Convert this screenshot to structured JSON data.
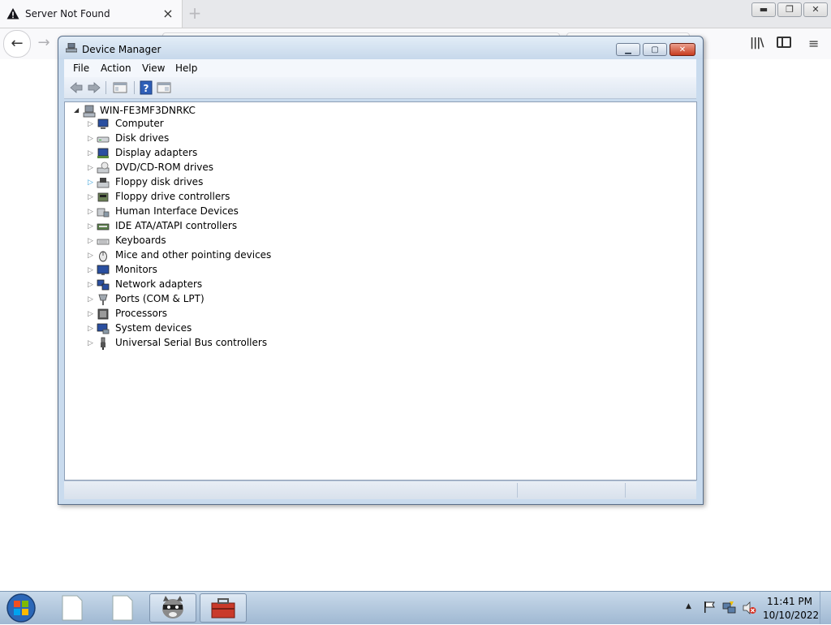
{
  "browser": {
    "tab_title": "Server Not Found",
    "tab_close": "×",
    "new_tab": "+",
    "back": "←",
    "forward": "→",
    "library": "|||\\",
    "menu": "≡"
  },
  "window": {
    "title": "Device Manager",
    "menus": [
      "File",
      "Action",
      "View",
      "Help"
    ],
    "root_node": "WIN-FE3MF3DNRKC",
    "categories": [
      {
        "label": "Computer",
        "icon": "computer-icon"
      },
      {
        "label": "Disk drives",
        "icon": "disk-drive-icon"
      },
      {
        "label": "Display adapters",
        "icon": "display-adapter-icon"
      },
      {
        "label": "DVD/CD-ROM drives",
        "icon": "dvd-drive-icon"
      },
      {
        "label": "Floppy disk drives",
        "icon": "floppy-disk-icon"
      },
      {
        "label": "Floppy drive controllers",
        "icon": "floppy-controller-icon"
      },
      {
        "label": "Human Interface Devices",
        "icon": "hid-icon"
      },
      {
        "label": "IDE ATA/ATAPI controllers",
        "icon": "ide-controller-icon"
      },
      {
        "label": "Keyboards",
        "icon": "keyboard-icon"
      },
      {
        "label": "Mice and other pointing devices",
        "icon": "mouse-icon"
      },
      {
        "label": "Monitors",
        "icon": "monitor-icon"
      },
      {
        "label": "Network adapters",
        "icon": "network-adapter-icon"
      },
      {
        "label": "Ports (COM & LPT)",
        "icon": "port-icon"
      },
      {
        "label": "Processors",
        "icon": "processor-icon"
      },
      {
        "label": "System devices",
        "icon": "system-device-icon"
      },
      {
        "label": "Universal Serial Bus controllers",
        "icon": "usb-icon"
      }
    ]
  },
  "taskbar": {
    "time": "11:41 PM",
    "date": "10/10/2022",
    "buttons": [
      "file-icon",
      "file-icon",
      "raccoon-app-icon",
      "toolbox-app-icon"
    ]
  },
  "colors": {
    "titlebar": "#c7d8eb",
    "taskbar": "#9fb8d2",
    "close_button": "#c73c1f"
  }
}
